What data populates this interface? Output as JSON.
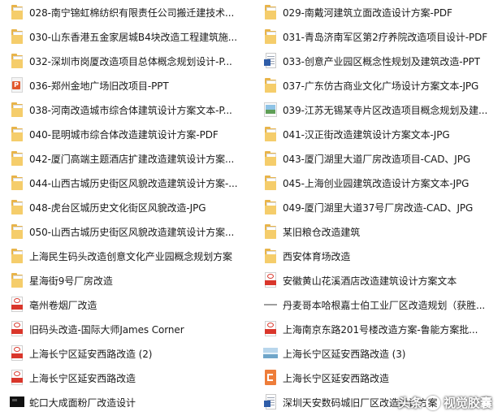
{
  "left_column": [
    {
      "icon": "folder-icon",
      "label": "028-南宁锦虹棉纺织有限责任公司搬迁建技术..."
    },
    {
      "icon": "folder-icon",
      "label": "030-山东香港五金家居城B4块改造工程建筑施..."
    },
    {
      "icon": "folder-icon",
      "label": "032-深圳市岗厦改造项目总体概念规划设计-P..."
    },
    {
      "icon": "ppt-icon",
      "label": "036-郑州金地广场旧改项目-PPT"
    },
    {
      "icon": "folder-icon",
      "label": "038-河南改造城市综合体建筑设计方案文本-P..."
    },
    {
      "icon": "folder-icon",
      "label": "040-昆明城市综合体改造建筑设计方案-PDF"
    },
    {
      "icon": "folder-icon",
      "label": "042-厦门高端主题酒店扩建改造建筑设计方案..."
    },
    {
      "icon": "folder-icon",
      "label": "044-山西古城历史街区风貌改造建筑设计方案-..."
    },
    {
      "icon": "folder-icon",
      "label": "048-虎台区城历史文化街区风貌改造-JPG"
    },
    {
      "icon": "folder-icon",
      "label": "050-山西古城历史街区风貌改造建筑设计方案..."
    },
    {
      "icon": "folder-icon",
      "label": "上海民生码头改造创意文化产业园概念规划方案"
    },
    {
      "icon": "folder-icon",
      "label": "星海街9号厂房改造"
    },
    {
      "icon": "pdf-icon",
      "label": "亳州卷烟厂改造"
    },
    {
      "icon": "pdf-icon",
      "label": "旧码头改造-国际大师James Corner"
    },
    {
      "icon": "pdf-icon",
      "label": "上海长宁区延安西路改造 (2)"
    },
    {
      "icon": "pdf-icon",
      "label": "上海长宁区延安西路改造"
    },
    {
      "icon": "dark-image-icon",
      "label": "蛇口大成面粉厂改造设计"
    }
  ],
  "right_column": [
    {
      "icon": "folder-icon",
      "label": "029-南戴河建筑立面改造设计方案-PDF"
    },
    {
      "icon": "folder-icon",
      "label": "031-青岛济南军区第2疗养院改造项目设计-PDF"
    },
    {
      "icon": "doc-icon",
      "label": "033-创意产业园区概念性规划及建筑改造-PPT"
    },
    {
      "icon": "folder-icon",
      "label": "037-广东仿古商业文化广场设计方案文本-JPG"
    },
    {
      "icon": "image-icon",
      "label": "039-江苏无锡某寺片区改造项目概念规划及建..."
    },
    {
      "icon": "folder-icon",
      "label": "041-汉正街改造建筑设计方案文本-JPG"
    },
    {
      "icon": "folder-icon",
      "label": "043-厦门湖里大道厂房改造项目-CAD、JPG"
    },
    {
      "icon": "folder-icon",
      "label": "045-上海创业园建筑改造设计方案文本-JPG"
    },
    {
      "icon": "folder-icon",
      "label": "049-厦门湖里大道37号厂房改造-CAD、JPG"
    },
    {
      "icon": "folder-icon",
      "label": "某旧粮仓改造建筑"
    },
    {
      "icon": "folder-icon",
      "label": "西安体育场改造"
    },
    {
      "icon": "pdf-icon",
      "label": "安徽黄山花溪酒店改造建筑设计方案文本"
    },
    {
      "icon": "stripe-icon",
      "label": "丹麦哥本哈根嘉士伯工业厂区改造规划（获胜..."
    },
    {
      "icon": "pdf-icon",
      "label": "上海南京东路201号楼改造方案-鲁能方案批..."
    },
    {
      "icon": "landscape-image-icon",
      "label": "上海长宁区延安西路改造 (3)"
    },
    {
      "icon": "orange-doc-icon",
      "label": "上海长宁区延安西路改造"
    },
    {
      "icon": "doc-icon",
      "label": "深圳天安数码城旧厂区改造设计方案"
    }
  ],
  "watermark": {
    "prefix": "头条",
    "sep": "@",
    "name": "视觉胶囊"
  }
}
